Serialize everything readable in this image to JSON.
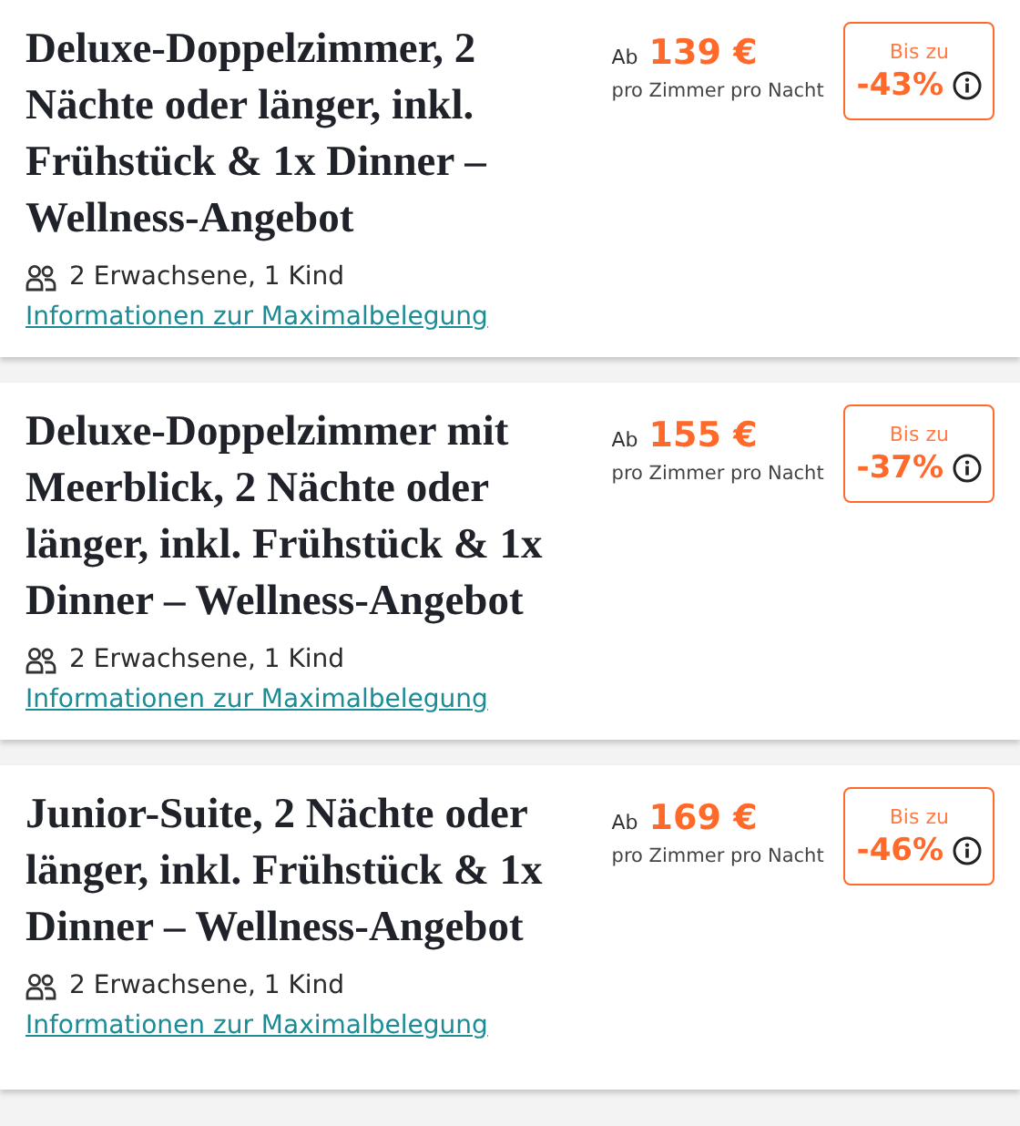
{
  "offers": [
    {
      "title": "Deluxe-Doppelzimmer, 2 Nächte oder länger, inkl. Frühstück & 1x Dinner – Wellness-Angebot",
      "occupancy": "2 Erwachsene, 1 Kind",
      "link": "Informationen zur Maximalbelegung",
      "price_prefix": "Ab",
      "price": "139 €",
      "price_note": "pro Zimmer pro Nacht",
      "discount_label": "Bis zu",
      "discount": "-43%"
    },
    {
      "title": "Deluxe-Doppelzimmer mit Meerblick, 2 Nächte oder länger, inkl. Frühstück & 1x Dinner – Wellness-Angebot",
      "occupancy": "2 Erwachsene, 1 Kind",
      "link": "Informationen zur Maximalbelegung",
      "price_prefix": "Ab",
      "price": "155 €",
      "price_note": "pro Zimmer pro Nacht",
      "discount_label": "Bis zu",
      "discount": "-37%"
    },
    {
      "title": "Junior-Suite, 2 Nächte oder länger, inkl. Frühstück & 1x Dinner – Wellness-Angebot",
      "occupancy": "2 Erwachsene, 1 Kind",
      "link": "Informationen zur Maximalbelegung",
      "price_prefix": "Ab",
      "price": "169 €",
      "price_note": "pro Zimmer pro Nacht",
      "discount_label": "Bis zu",
      "discount": "-46%"
    }
  ]
}
